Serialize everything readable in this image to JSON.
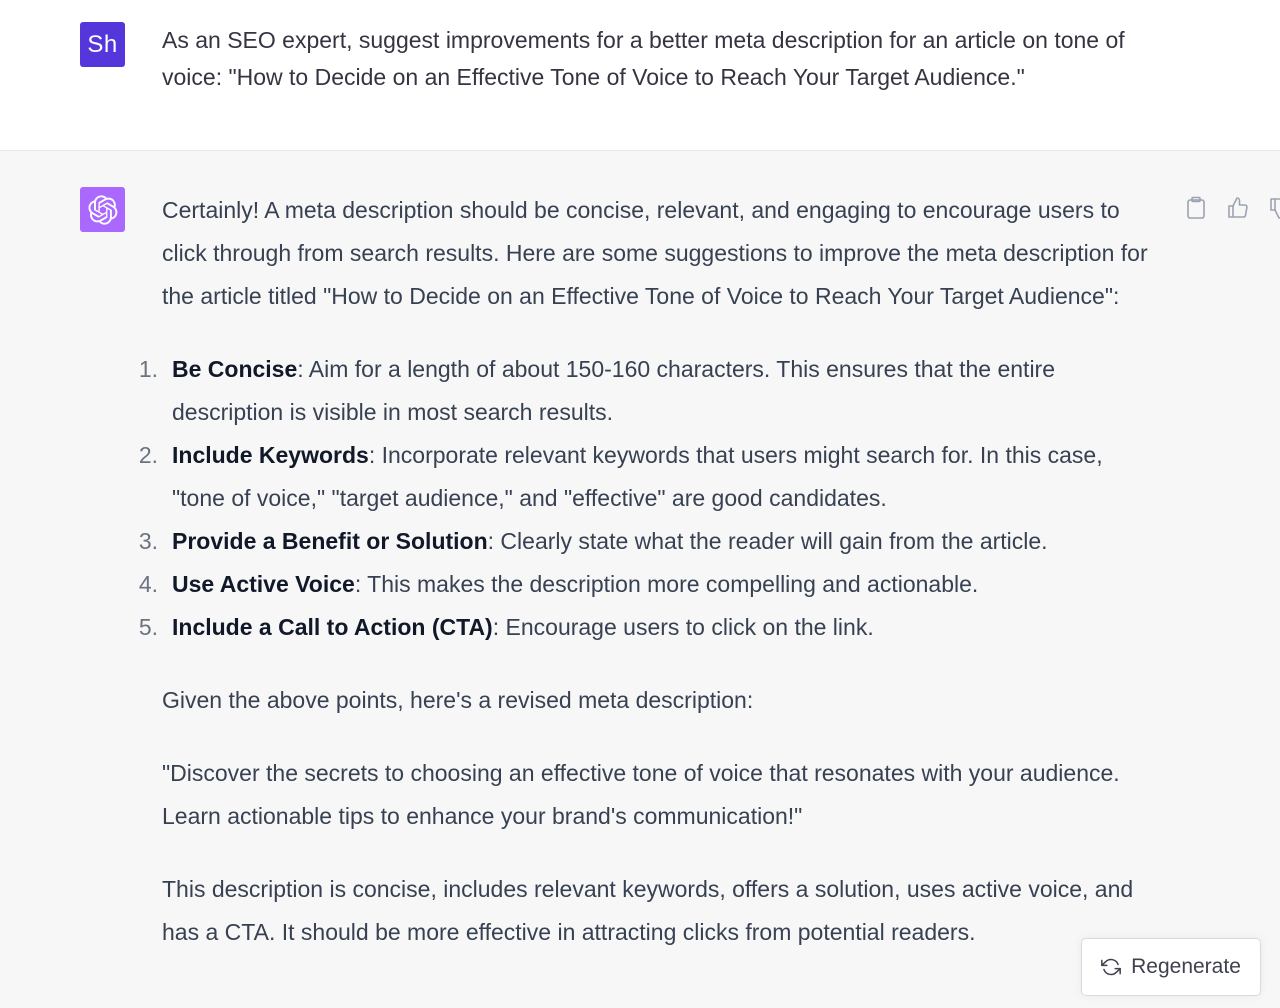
{
  "colors": {
    "user_avatar_bg": "#5436DA",
    "assistant_avatar_bg": "#AB68FF",
    "assistant_bg": "#f7f7f8",
    "user_bg": "#ffffff"
  },
  "user": {
    "avatar_initials": "Sh",
    "message": "As an SEO expert, suggest improvements for a better meta description for an article on tone of voice: \"How to Decide on an Effective Tone of Voice to Reach Your Target Audience.\""
  },
  "assistant": {
    "avatar_icon": "openai-logo-icon",
    "intro": "Certainly! A meta description should be concise, relevant, and engaging to encourage users to click through from search results. Here are some suggestions to improve the meta description for the article titled \"How to Decide on an Effective Tone of Voice to Reach Your Target Audience\":",
    "points": [
      {
        "number": "1.",
        "title": "Be Concise",
        "text": ": Aim for a length of about 150-160 characters. This ensures that the entire description is visible in most search results."
      },
      {
        "number": "2.",
        "title": "Include Keywords",
        "text": ": Incorporate relevant keywords that users might search for. In this case, \"tone of voice,\" \"target audience,\" and \"effective\" are good candidates."
      },
      {
        "number": "3.",
        "title": "Provide a Benefit or Solution",
        "text": ": Clearly state what the reader will gain from the article."
      },
      {
        "number": "4.",
        "title": "Use Active Voice",
        "text": ": This makes the description more compelling and actionable."
      },
      {
        "number": "5.",
        "title": "Include a Call to Action (CTA)",
        "text": ": Encourage users to click on the link."
      }
    ],
    "lead_in": "Given the above points, here's a revised meta description:",
    "revised": "\"Discover the secrets to choosing an effective tone of voice that resonates with your audience. Learn actionable tips to enhance your brand's communication!\"",
    "closing": "This description is concise, includes relevant keywords, offers a solution, uses active voice, and has a CTA. It should be more effective in attracting clicks from potential readers."
  },
  "actions": {
    "icons": [
      "clipboard-icon",
      "thumbs-up-icon",
      "thumbs-down-icon"
    ]
  },
  "regenerate": {
    "icon": "refresh-icon",
    "label": "Regenerate"
  }
}
